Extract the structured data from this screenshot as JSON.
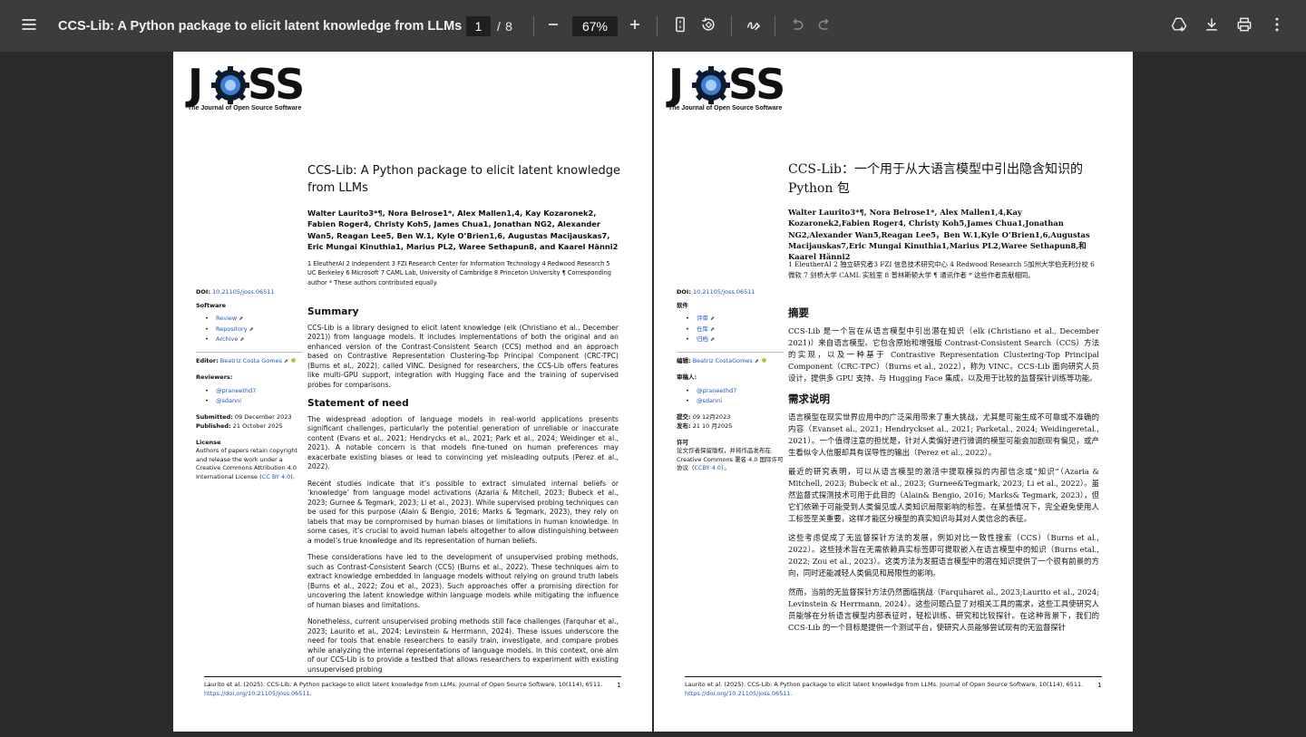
{
  "toolbar": {
    "title": "CCS-Lib: A Python package to elicit latent knowledge from LLMs",
    "page_current": "1",
    "page_sep": "/",
    "page_total": "8",
    "zoom": "67%",
    "icons": [
      "menu-icon",
      "zoom-out-icon",
      "zoom-in-icon",
      "fit-page-icon",
      "rotate-icon",
      "draw-icon",
      "undo-icon",
      "redo-icon",
      "drive-icon",
      "download-icon",
      "print-icon",
      "more-vert-icon"
    ]
  },
  "left_page": {
    "logo_text": "JOSS",
    "logo_tagline": "The Journal of Open Source Software",
    "title": "CCS-Lib: A Python package to elicit latent knowledge from LLMs",
    "authors": "Walter Laurito3*¶, Nora Belrose1*, Alex Mallen1,4, Kay Kozaronek2, Fabien Roger4, Christy Koh5, James Chua1, Jonathan NG2, Alexander Wan5, Reagan Lee5, Ben W.1, Kyle O’Brien1,6, Augustas Macijauskas7, Eric Mungai Kinuthia1, Marius PL2, Waree Sethapun8, and Kaarel Hänni2",
    "affiliations": "1 EleutherAI 2 Independent 3 FZI Research Center for Information Technology 4 Redwood Research 5 UC Berkeley 6 Microsoft 7 CAML Lab, University of Cambridge 8 Princeton University ¶ Corresponding author * These authors contributed equally.",
    "sidebar": {
      "doi_label": "DOI:",
      "doi_value": "10.21105/joss.06511",
      "software_label": "Software",
      "software_links": [
        "Review",
        "Repository",
        "Archive"
      ],
      "editor_label": "Editor:",
      "editor_name": "Beatriz Costa Gomes",
      "reviewers_label": "Reviewers:",
      "reviewers": [
        "@praneethd7",
        "@sdanni"
      ],
      "submitted_label": "Submitted:",
      "submitted_value": "09 December 2023",
      "published_label": "Published:",
      "published_value": "21 October 2025",
      "license_label": "License",
      "license_text": "Authors of papers retain copyright and release the work under a Creative Commons Attribution 4.0 International License (",
      "license_link": "CC BY 4.0",
      "license_end": ")."
    },
    "summary_heading": "Summary",
    "summary_text": "CCS-Lib is a library designed to elicit latent knowledge (elk (Christiano et al., December 2021)) from language models. It includes implementations of both the original and an enhanced version of the Contrast-Consistent Search (CCS) method and an approach based on Contrastive Representation Clustering-Top Principal Component (CRC-TPC) (Burns et al., 2022), called VINC. Designed for researchers, the CCS-Lib offers features like multi-GPU support, integration with Hugging Face and the training of supervised probes for comparisons.",
    "need_heading": "Statement of need",
    "need_paragraphs": [
      "The widespread adoption of language models in real-world applications presents significant challenges, particularly the potential generation of unreliable or inaccurate content (Evans et al., 2021; Hendrycks et al., 2021; Park et al., 2024; Weidinger et al., 2021). A notable concern is that models fine-tuned on human preferences may exacerbate existing biases or lead to convincing yet misleading outputs (Perez et al., 2022).",
      "Recent studies indicate that it’s possible to extract simulated internal beliefs or ‘knowledge’ from language model activations (Azaria & Mitchell, 2023; Bubeck et al., 2023; Gurnee & Tegmark, 2023; Li et al., 2023). While supervised probing techniques can be used for this purpose (Alain & Bengio, 2016; Marks & Tegmark, 2023), they rely on labels that may be compromised by human biases or limitations in human knowledge. In some cases, it’s crucial to avoid human labels altogether to allow distinguishing between a model’s true knowledge and its representation of human beliefs.",
      "These considerations have led to the development of unsupervised probing methods, such as Contrast-Consistent Search (CCS) (Burns et al., 2022). These techniques aim to extract knowledge embedded in language models without relying on ground truth labels (Burns et al., 2022; Zou et al., 2023). Such approaches offer a promising direction for uncovering the latent knowledge within language models while mitigating the influence of human biases and limitations.",
      "Nonetheless, current unsupervised probing methods still face challenges (Farquhar et al., 2023; Laurito et al., 2024; Levinstein & Herrmann, 2024). These issues underscore the need for tools that enable researchers to easily train, investigate, and compare probes while analyzing the internal representations of language models. In this context, one aim of our CCS-Lib is to provide a testbed that allows researchers to experiment with existing unsupervised probing"
    ],
    "footer_text": "Laurito et al. (2025). CCS-Lib: A Python package to elicit latent knowledge from LLMs. Journal of Open Source Software, 10(114), 6511.",
    "footer_doi": "https://doi.org/10.21105/joss.06511.",
    "footer_page": "1"
  },
  "right_page": {
    "logo_text": "JOSS",
    "logo_tagline": "The Journal of Open Source Software",
    "title": "CCS-Lib：一个用于从大语言模型中引出隐含知识的 Python 包",
    "authors": "Walter Laurito3*¶, Nora Belrose1*, Alex Mallen1,4,Kay Kozaronek2,Fabien Roger4, Christy Koh5,James Chua1,Jonathan NG2,Alexander Wan5,Reagan Lee5，Ben W.1,Kyle O’Brien1,6,Augustas Macijauskas7,Eric Mungai Kinuthia1,Marius PL2,Waree Sethapun8,和 Kaarel Hänni2",
    "affiliations": "1 EleutherAI 2 独立研究者3 FZI 信息技术研究中心 4 Redwood Research 5加州大学伯克利分校 6 微软 7 剑桥大学 CAML 实验室 8 普林斯顿大学 ¶ 通讯作者 * 这些作者贡献相同。",
    "sidebar": {
      "doi_label": "DOI:",
      "doi_value": "10.21105/joss.06511",
      "software_label": "软件",
      "software_links": [
        "评审",
        "仓库",
        "归档"
      ],
      "editor_label": "编辑:",
      "editor_name": "Beatriz CostaGomes",
      "reviewers_label": "审稿人:",
      "reviewers": [
        "@praneethd7",
        "@sdanni"
      ],
      "submitted_label": "提交:",
      "submitted_value": "09 12月2023",
      "published_label": "发布:",
      "published_value": "21 10 月2025",
      "license_label": "许可",
      "license_text": "论文作者保留版权，并将作品发布在 Creative Commons 署名 4.0 国际许可协议（",
      "license_link": "CCBY 4.0",
      "license_end": "）。"
    },
    "summary_heading": "摘要",
    "summary_text": "CCS-Lib 是一个旨在从语言模型中引出潜在知识（elk (Christiano et al., December 2021)）来自语言模型。它包含原始和增强版 Contrast-Consistent Search（CCS）方法的实现，以及一种基于 Contrastive Representation Clustering-Top Principal Component（CRC-TPC）（Burns et al., 2022），称为 VINC。CCS-Lib 面向研究人员设计，提供多 GPU 支持、与 Hugging Face 集成，以及用于比较的监督探针训练等功能。",
    "need_heading": "需求说明",
    "need_paragraphs": [
      "语言模型在现实世界应用中的广泛采用带来了重大挑战，尤其是可能生成不可靠或不准确的内容（Evanset al., 2021; Hendryckset al., 2021; Parketal., 2024; Weidingeretal., 2021）。一个值得注意的担忧是，针对人类偏好进行微调的模型可能会加剧现有偏见，或产生看似令人信服却具有误导性的输出（Perez et al., 2022）。",
      "最近的研究表明，可以从语言模型的激活中提取模拟的内部信念或“知识”（Azaria & Mitchell, 2023; Bubeck et al., 2023; Gurnee&Tegmark, 2023; Li et al., 2022）。虽然监督式探测技术可用于此目的（Alain& Bengio, 2016; Marks& Tegmark, 2023），但它们依赖于可能受到人类偏见或人类知识局限影响的标签。在某些情况下，完全避免使用人工标签至关重要，这样才能区分模型的真实知识与其对人类信念的表征。",
      "这些考虑促成了无监督探针方法的发展，例如对比一致性搜索（CCS）（Burns et al., 2022）。这些技术旨在无需依赖真实标签即可提取嵌入在语言模型中的知识（Burns etal., 2022; Zou et al., 2023）。这类方法为发掘语言模型中的潜在知识提供了一个很有前景的方向，同时还能减轻人类偏见和局限性的影响。",
      "然而，当前的无监督探针方法仍然面临挑战（Farquharet al., 2023;Laurito et al., 2024; Levinstein & Herrmann, 2024）。这些问题凸显了对相关工具的需求，这些工具使研究人员能够在分析语言模型内部表征时，轻松训练、研究和比较探针。在这种背景下，我们的 CCS-Lib 的一个目标是提供一个测试平台，使研究人员能够尝试现有的无监督探针"
    ],
    "footer_text": "Laurito et al. (2025). CCS-Lib: A Python package to elicit latent knowledge from LLMs. Journal of Open Source Software, 10(114), 6511.",
    "footer_doi": "https://doi.org/10.21105/joss.06511.",
    "footer_page": "1"
  }
}
